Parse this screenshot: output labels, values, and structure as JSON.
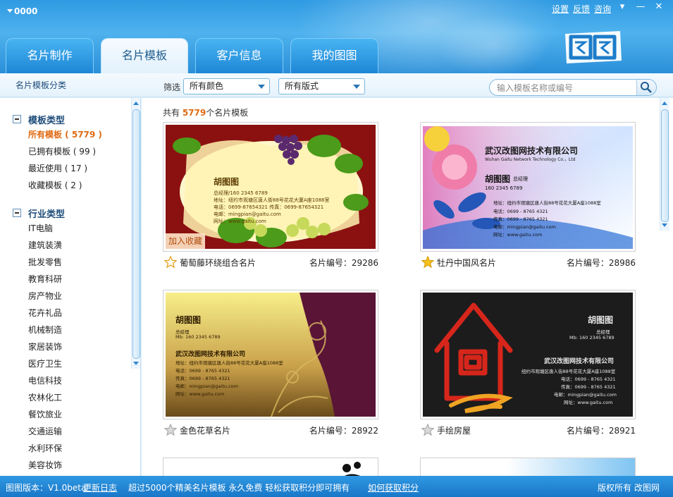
{
  "app": {
    "title": "0000"
  },
  "top_links": [
    "设置",
    "反馈",
    "咨询"
  ],
  "window_buttons": {
    "menu": "▾",
    "minimize": "—",
    "close": "✕"
  },
  "tabs": [
    {
      "label": "名片制作",
      "active": false
    },
    {
      "label": "名片模板",
      "active": true
    },
    {
      "label": "客户信息",
      "active": false
    },
    {
      "label": "我的图图",
      "active": false
    }
  ],
  "sidebar": {
    "title": "名片模板分类",
    "groups": [
      {
        "label": "模板类型",
        "items": [
          "所有模板 ( 5779 )",
          "已拥有模板 ( 99 )",
          "最近使用 ( 17 )",
          "收藏模板 ( 2 )"
        ]
      },
      {
        "label": "行业类型",
        "items": [
          "IT电脑",
          "建筑装潢",
          "批发零售",
          "教育科研",
          "房产物业",
          "花卉礼品",
          "机械制造",
          "家居装饰",
          "医疗卫生",
          "电信科技",
          "农林化工",
          "餐饮旅业",
          "交通运输",
          "水利环保",
          "美容妆饰"
        ]
      }
    ]
  },
  "filter": {
    "label": "筛选",
    "color_select": "所有颜色",
    "layout_select": "所有版式",
    "search_placeholder": "输入模板名称或编号"
  },
  "main": {
    "count_prefix": "共有 ",
    "count": "5779",
    "count_suffix": "个名片模板",
    "fav_badge": "加入收藏",
    "cards": [
      {
        "name": "葡萄藤环绕组合名片",
        "number": "名片编号：29286",
        "starred": false
      },
      {
        "name": "牡丹中国风名片",
        "number": "名片编号：28986",
        "starred": true
      },
      {
        "name": "金色花草名片",
        "number": "名片编号：28922",
        "starred": false
      },
      {
        "name": "手绘房屋",
        "number": "名片编号：28921",
        "starred": false
      }
    ]
  },
  "card_text": {
    "person": "胡图图",
    "title_manager": "总经理",
    "mobile": "160 2345 6789",
    "mobile_prefixed": "总经理/160 2345 6789",
    "mb": "Mb: 160 2345 6789",
    "company": "武汉改图网技术有限公司",
    "company_en": "Wuhan Gaitu Network Technology Co.，Ltd",
    "address": "地址：纽约市观塘区唐人街88号花花大厦A座1088室",
    "address_plain": "纽约市观塘区唐人街88号花花大厦A座1088室",
    "phone_fax": "电话：0699-87654321  传真：0699-87654321",
    "phone": "电话：0699 - 8765 4321",
    "fax": "传真：0699 - 8765 4321",
    "email": "电邮：mingpian@gaitu.com",
    "web": "网址：www.gaitu.com"
  },
  "footer": {
    "version": "图图版本：V1.0beta",
    "changelog": "更新日志",
    "promo": "超过5000个精美名片模板 永久免费   轻松获取积分即可拥有",
    "how_points": "如何获取积分",
    "copyright": "版权所有 改图网"
  },
  "colors": {
    "accent": "#e06a12",
    "header_blue": "#2f9ae2",
    "tab_text_active": "#1f5d8f"
  }
}
